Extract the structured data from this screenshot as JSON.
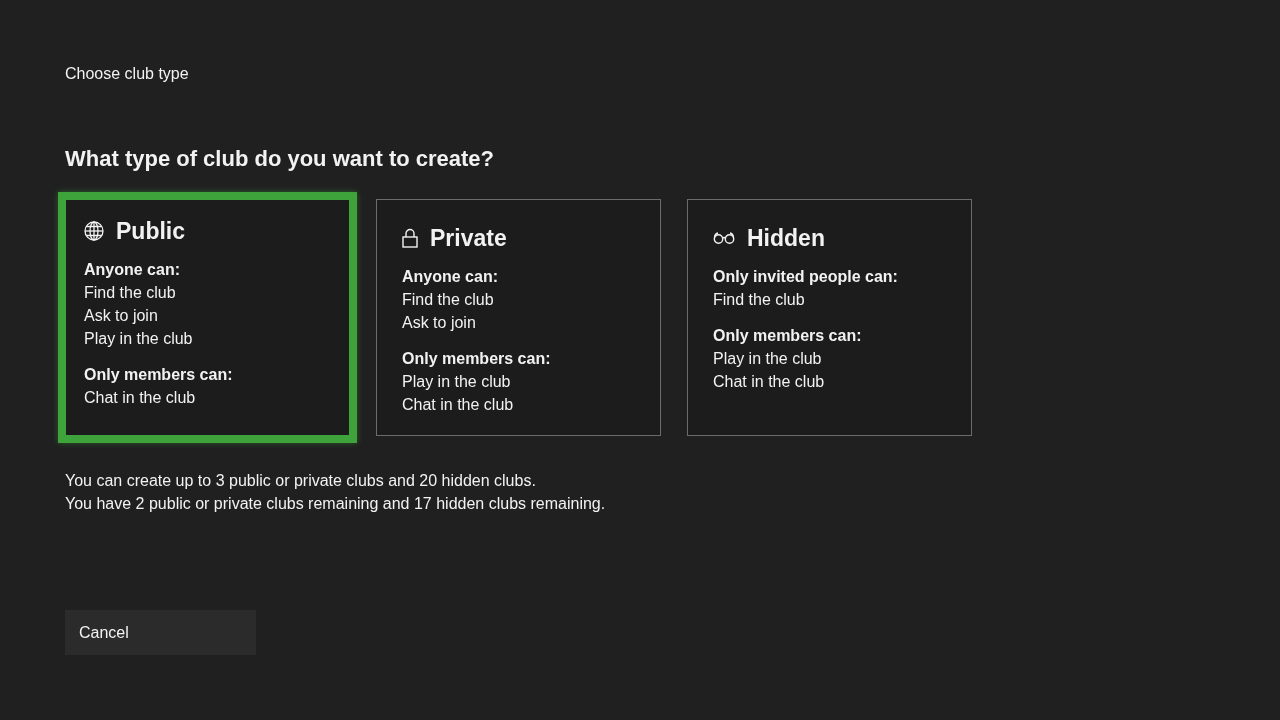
{
  "page": {
    "title": "Choose club type",
    "heading": "What type of club do you want to create?"
  },
  "club_types": [
    {
      "kind": "public",
      "name": "Public",
      "selected": true,
      "groups": [
        {
          "heading": "Anyone can:",
          "items": [
            "Find the club",
            "Ask to join",
            "Play in the club"
          ]
        },
        {
          "heading": "Only members can:",
          "items": [
            "Chat in the club"
          ]
        }
      ]
    },
    {
      "kind": "private",
      "name": "Private",
      "selected": false,
      "groups": [
        {
          "heading": "Anyone can:",
          "items": [
            "Find the club",
            "Ask to join"
          ]
        },
        {
          "heading": "Only members can:",
          "items": [
            "Play in the club",
            "Chat in the club"
          ]
        }
      ]
    },
    {
      "kind": "hidden",
      "name": "Hidden",
      "selected": false,
      "groups": [
        {
          "heading": "Only invited people can:",
          "items": [
            "Find the club"
          ]
        },
        {
          "heading": "Only members can:",
          "items": [
            "Play in the club",
            "Chat in the club"
          ]
        }
      ]
    }
  ],
  "notes": [
    "You can create up to 3 public or private clubs and 20 hidden clubs.",
    "You have 2 public or private clubs remaining and 17 hidden clubs remaining."
  ],
  "buttons": [
    {
      "label": "Cancel"
    }
  ]
}
